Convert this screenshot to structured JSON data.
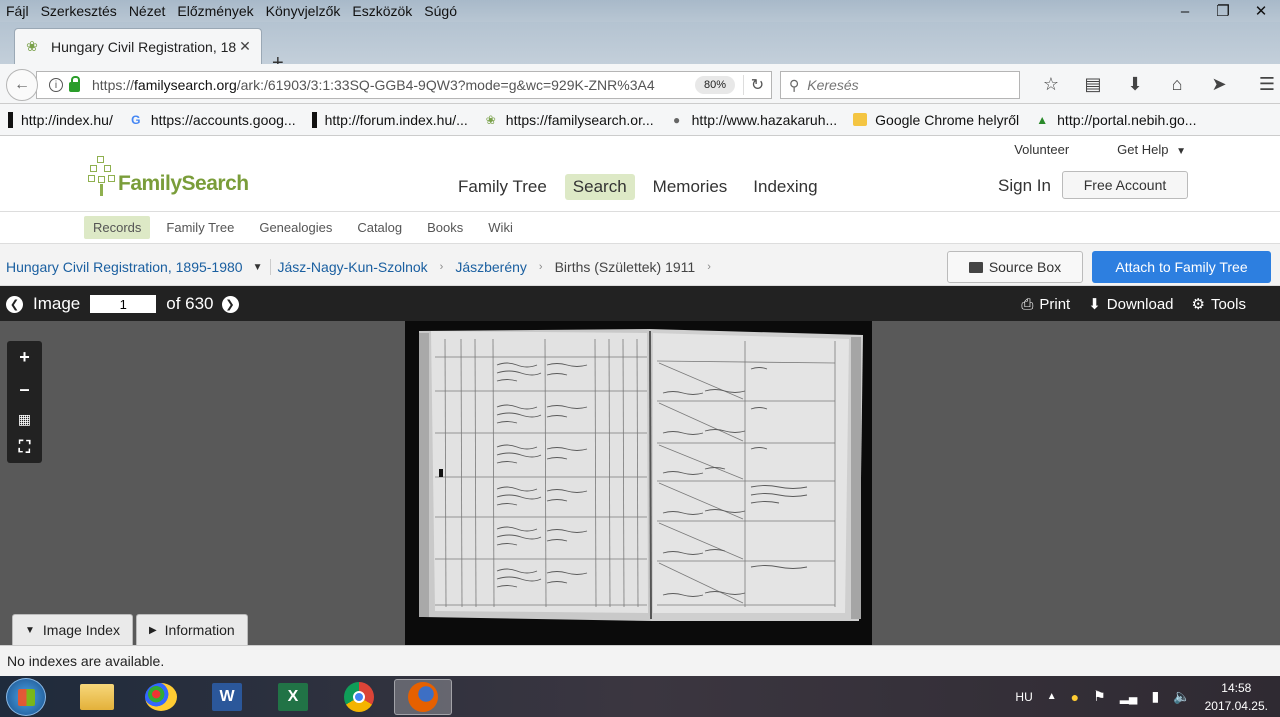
{
  "browser": {
    "menu": [
      "Fájl",
      "Szerkesztés",
      "Nézet",
      "Előzmények",
      "Könyvjelzők",
      "Eszközök",
      "Súgó"
    ],
    "tab_title": "Hungary Civil Registration, 18",
    "url_prefix": "https://",
    "url_host": "familysearch.org",
    "url_path": "/ark:/61903/3:1:33SQ-GGB4-9QW3?mode=g&wc=929K-ZNR%3A4",
    "zoom": "80%",
    "search_placeholder": "Keresés",
    "bookmarks": [
      {
        "label": "http://index.hu/",
        "icon": "index-icon"
      },
      {
        "label": "https://accounts.goog...",
        "icon": "google-icon"
      },
      {
        "label": "http://forum.index.hu/...",
        "icon": "index-icon"
      },
      {
        "label": "https://familysearch.or...",
        "icon": "familysearch-icon"
      },
      {
        "label": "http://www.hazakaruh...",
        "icon": "globe-icon"
      },
      {
        "label": "Google Chrome helyről",
        "icon": "folder-icon"
      },
      {
        "label": "http://portal.nebih.go...",
        "icon": "nebih-icon"
      }
    ]
  },
  "site": {
    "logo": "FamilySearch",
    "top_links": [
      "Volunteer",
      "Get Help"
    ],
    "nav": [
      "Family Tree",
      "Search",
      "Memories",
      "Indexing"
    ],
    "active_nav": "Search",
    "sign_in": "Sign In",
    "free_account": "Free Account",
    "subnav": [
      "Records",
      "Family Tree",
      "Genealogies",
      "Catalog",
      "Books",
      "Wiki"
    ],
    "active_subnav": "Records"
  },
  "breadcrumb": {
    "collection": "Hungary Civil Registration, 1895-1980",
    "county": "Jász-Nagy-Kun-Szolnok",
    "town": "Jászberény",
    "current": "Births (Születtek) 1911",
    "source_box": "Source Box",
    "attach": "Attach to Family Tree"
  },
  "viewer": {
    "image_label": "Image",
    "page_value": "1",
    "of_label": "of 630",
    "print": "Print",
    "download": "Download",
    "tools": "Tools",
    "panel_tabs": [
      "Image Index",
      "Information"
    ],
    "status": "No indexes are available."
  },
  "taskbar": {
    "lang": "HU",
    "time": "14:58",
    "date": "2017.04.25."
  }
}
